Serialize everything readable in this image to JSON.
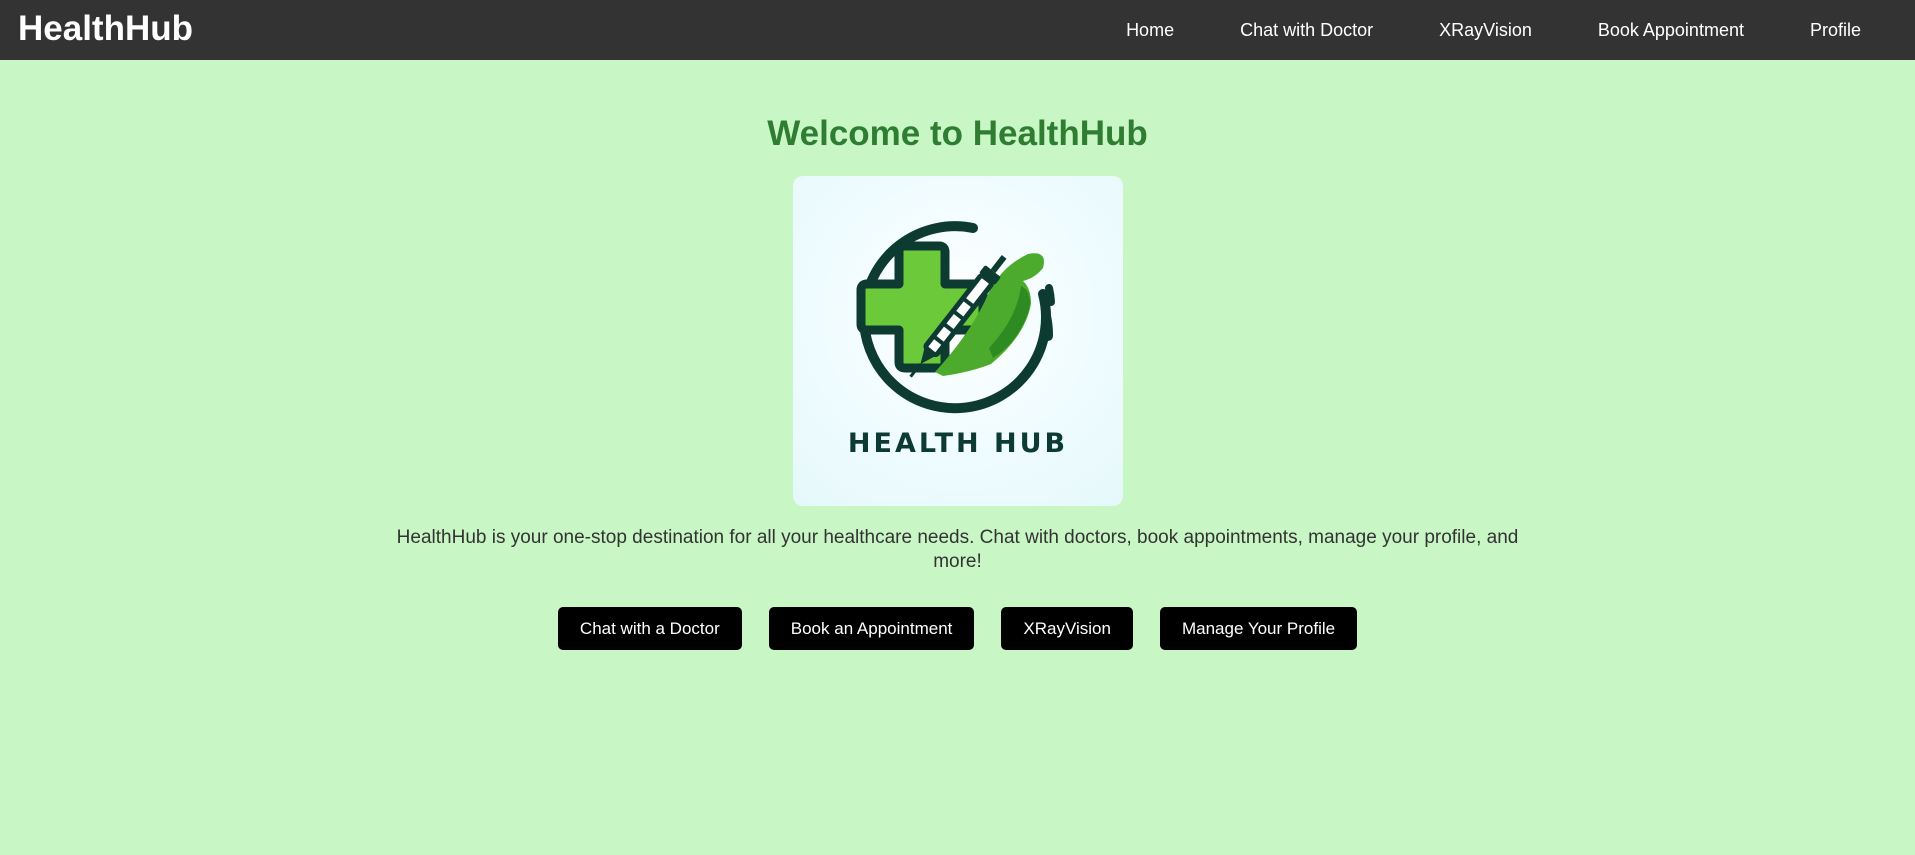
{
  "navbar": {
    "brand": "HealthHub",
    "links": [
      "Home",
      "Chat with Doctor",
      "XRayVision",
      "Book Appointment",
      "Profile"
    ]
  },
  "main": {
    "title": "Welcome to HealthHub",
    "logo": {
      "text": "HEALTH HUB",
      "icon": "medical-cross-with-syringe-icon"
    },
    "description": "HealthHub is your one-stop destination for all your healthcare needs. Chat with doctors, book appointments, manage your profile, and more!",
    "buttons": [
      "Chat with a Doctor",
      "Book an Appointment",
      "XRayVision",
      "Manage Your Profile"
    ]
  },
  "colors": {
    "background": "#c8f7c5",
    "navbar": "#333333",
    "title": "#2e7d32",
    "button": "#000000",
    "logo_dark": "#0d3b32",
    "logo_green": "#6cc93a"
  }
}
